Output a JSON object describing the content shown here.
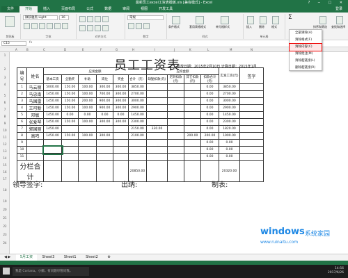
{
  "window": {
    "title": "最新员工excel工资表模板.xls [兼容模式] - Excel",
    "controls": "? ─ □ ✕"
  },
  "tabs": [
    "开始",
    "插入",
    "页面布局",
    "公式",
    "数据",
    "审阅",
    "视图",
    "开发工具"
  ],
  "file_tab": "文件",
  "active_tab": "开始",
  "login": "登录",
  "ribbon": {
    "font": "微软雅黑 Light",
    "size": "16",
    "format": "常规",
    "groups": [
      "剪贴板",
      "字体",
      "对齐方式",
      "数字",
      "样式",
      "单元格",
      "编辑"
    ],
    "buttons": [
      "条件格式",
      "套用表格格式",
      "单元格样式",
      "插入",
      "删除",
      "格式",
      "排序和筛选",
      "查找和选择"
    ]
  },
  "formula": {
    "namebox": "C15",
    "fx": "fx"
  },
  "columns": [
    "A",
    "B",
    "C",
    "D",
    "E",
    "F",
    "G",
    "H",
    "I",
    "J",
    "K",
    "L",
    "M",
    "N"
  ],
  "rows": [
    "1",
    "2",
    "3",
    "4",
    "5",
    "6",
    "7",
    "8",
    "9",
    "10",
    "11",
    "12",
    "13",
    "14",
    "15",
    "16",
    "17",
    "18",
    "19",
    "20",
    "21",
    "22",
    "23",
    "24"
  ],
  "sheet": {
    "title": "员工工资表",
    "dateinfo": "发放日期：2015年2月10日  计算日期：2015年1月",
    "head": {
      "no": "编号",
      "name": "姓名",
      "income": "应发金额",
      "deduct": "应扣金额",
      "total": "合计（元）",
      "real": "实发工资(元)",
      "sign": "签字",
      "cols": [
        "基本工资",
        "全勤奖",
        "补助",
        "岗位",
        "奖金",
        "合计（元）",
        "缺勤扣款(元)",
        "迟到扣款(元)",
        "其它扣款(元)",
        "扣款合计(元)"
      ]
    },
    "rows": [
      [
        "1",
        "马云丽",
        "5000.00",
        "150.00",
        "100.00",
        "300.00",
        "300.00",
        "3850.00",
        "",
        "",
        "",
        "0.00",
        "3850.00"
      ],
      [
        "2",
        "马忠南",
        "1450.00",
        "150.00",
        "100.00",
        "700.00",
        "300.00",
        "2700.00",
        "",
        "",
        "",
        "0.00",
        "2700.00"
      ],
      [
        "3",
        "马国雷",
        "1450.00",
        "150.00",
        "200.00",
        "900.00",
        "300.00",
        "3000.00",
        "",
        "",
        "",
        "0.00",
        "3000.00"
      ],
      [
        "4",
        "王可新",
        "1450.00",
        "150.00",
        "100.00",
        "900.00",
        "300.00",
        "2900.00",
        "",
        "",
        "",
        "0.00",
        "2900.00"
      ],
      [
        "5",
        "邓敏",
        "1450.00",
        "0.00",
        "0.00",
        "0.00",
        "0.00",
        "1450.00",
        "",
        "",
        "",
        "0.00",
        "1450.00"
      ],
      [
        "6",
        "张爱琴",
        "1450.00",
        "150.00",
        "100.00",
        "300.00",
        "300.00",
        "2300.00",
        "",
        "",
        "",
        "0.00",
        "2300.00"
      ],
      [
        "7",
        "郭国丽",
        "1450.00",
        "",
        "",
        "",
        "",
        "2150.00",
        "330.00",
        "",
        "",
        "0.00",
        "1820.00"
      ],
      [
        "8",
        "高鸣",
        "1450.00",
        "150.00",
        "100.00",
        "300.00",
        "",
        "2100.00",
        "",
        "",
        "200.00",
        "200.00",
        "1900.00"
      ],
      [
        "9",
        "",
        "",
        "",
        "",
        "",
        "",
        "",
        "",
        "",
        "",
        "0.00",
        "0.00"
      ],
      [
        "10",
        "",
        "",
        "",
        "",
        "",
        "",
        "",
        "",
        "",
        "",
        "0.00",
        "0.00"
      ],
      [
        "11",
        "",
        "",
        "",
        "",
        "",
        "",
        "",
        "",
        "",
        "",
        "0.00",
        "0.00"
      ]
    ],
    "subtotal": {
      "label": "分栏合计",
      "total": "20850.00",
      "real": "20320.00"
    },
    "signs": {
      "leader": "领导签字:",
      "cashier": "出纳:",
      "maker": "制表:"
    }
  },
  "sheettabs": [
    "5月工资",
    "Sheet3",
    "Sheet1",
    "Sheet2"
  ],
  "dropdown": [
    "全部清除(A)",
    "清除格式(F)",
    "清除内容(C)",
    "清除批注(M)",
    "清除超链接(L)",
    "删除超链接(R)"
  ],
  "taskbar": {
    "search": "我是 Cortana，小娜。有问题尽管问我。",
    "time": "14:56",
    "date": "2017/6/26"
  },
  "watermark": {
    "brand": "windows",
    "sub": "系统家园",
    "url": "www.ruinaitu.com"
  }
}
